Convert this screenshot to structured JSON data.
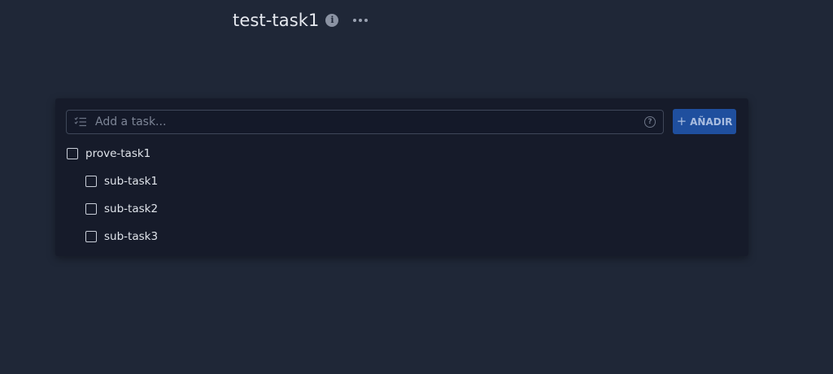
{
  "header": {
    "title": "test-task1",
    "info_icon": "info-icon",
    "more_icon": "more-horizontal-icon"
  },
  "add_task": {
    "placeholder": "Add a task...",
    "value": "",
    "list_icon": "list-check-icon",
    "help_icon": "question-circle-icon",
    "help_glyph": "?",
    "button_label": "AÑADIR",
    "button_icon": "+"
  },
  "tasks": [
    {
      "label": "prove-task1",
      "checked": false,
      "level": 0
    },
    {
      "label": "sub-task1",
      "checked": false,
      "level": 1
    },
    {
      "label": "sub-task2",
      "checked": false,
      "level": 1
    },
    {
      "label": "sub-task3",
      "checked": false,
      "level": 1
    }
  ],
  "colors": {
    "background": "#1f2737",
    "card": "#161b2a",
    "accent_button": "#1f4f9e",
    "text": "#dfe3ea"
  }
}
